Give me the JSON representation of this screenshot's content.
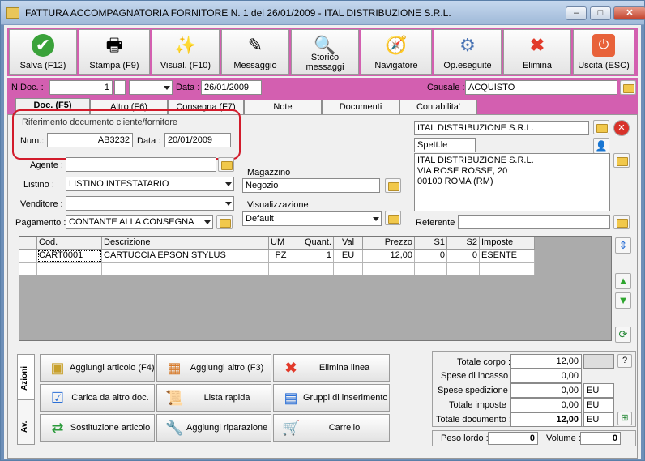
{
  "window": {
    "title": "FATTURA ACCOMPAGNATORIA FORNITORE N. 1  del 26/01/2009 - ITAL DISTRIBUZIONE S.R.L.",
    "min": "–",
    "max": "□",
    "close": "✕"
  },
  "toolbar": {
    "salva": "Salva (F12)",
    "stampa": "Stampa (F9)",
    "visual": "Visual. (F10)",
    "messaggio": "Messaggio",
    "storico": "Storico\nmessaggi",
    "navigatore": "Navigatore",
    "opeseguite": "Op.eseguite",
    "elimina": "Elimina",
    "uscita": "Uscita (ESC)"
  },
  "header": {
    "ndoc_label": "N.Doc. :",
    "ndoc_value": "1",
    "data_label": "Data :",
    "data_value": "26/01/2009",
    "causale_label": "Causale :",
    "causale_value": "ACQUISTO"
  },
  "tabs": [
    "Doc. (F5)",
    "Altro (F6)",
    "Consegna (F7)",
    "Note",
    "Documenti",
    "Contabilita'"
  ],
  "riferimento": {
    "title": "Riferimento documento cliente/fornitore",
    "num_label": "Num.:",
    "num_value": "AB3232",
    "data_label": "Data :",
    "data_value": "20/01/2009"
  },
  "form": {
    "agente_label": "Agente :",
    "agente_value": "",
    "listino_label": "Listino :",
    "listino_value": "LISTINO INTESTATARIO",
    "venditore_label": "Venditore :",
    "venditore_value": "",
    "pagamento_label": "Pagamento :",
    "pagamento_value": "CONTANTE ALLA CONSEGNA",
    "magazzino_label": "Magazzino",
    "magazzino_value": "Negozio",
    "visualizzazione_label": "Visualizzazione",
    "visualizzazione_value": "Default"
  },
  "cliente": {
    "name": "ITAL DISTRIBUZIONE S.R.L.",
    "spett": "Spett.le",
    "address": [
      "ITAL DISTRIBUZIONE S.R.L.",
      "VIA ROSE ROSSE, 20",
      "00100 ROMA (RM)"
    ],
    "referente_label": "Referente",
    "referente_value": ""
  },
  "grid": {
    "columns": [
      "Cod.",
      "Descrizione",
      "UM",
      "Quant.",
      "Val",
      "Prezzo",
      "S1",
      "S2",
      "Imposte"
    ],
    "rows": [
      [
        "CART0001",
        "CARTUCCIA EPSON STYLUS",
        "PZ",
        "1",
        "EU",
        "12,00",
        "0",
        "0",
        "ESENTE"
      ]
    ]
  },
  "actions": {
    "tab_azioni": "Azioni",
    "tab_av": "Av.",
    "aggiungi_articolo": "Aggiungi articolo (F4)",
    "aggiungi_altro": "Aggiungi altro (F3)",
    "elimina_linea": "Elimina linea",
    "carica": "Carica da altro doc.",
    "lista_rapida": "Lista rapida",
    "gruppi": "Gruppi di inserimento",
    "sostituzione": "Sostituzione articolo",
    "aggiungi_riparazione": "Aggiungi riparazione",
    "carrello": "Carrello"
  },
  "totals": {
    "corpo_label": "Totale corpo :",
    "corpo_value": "12,00",
    "help": "?",
    "incasso_label": "Spese di incasso :",
    "incasso_value": "0,00",
    "spedizione_label": "Spese spedizione :",
    "spedizione_value": "0,00",
    "spedizione_cur": "EU",
    "imposte_label": "Totale imposte :",
    "imposte_value": "0,00",
    "imposte_cur": "EU",
    "documento_label": "Totale documento :",
    "documento_value": "12,00",
    "documento_cur": "EU",
    "peso_label": "Peso lordo :",
    "peso_value": "0",
    "volume_label": "Volume :",
    "volume_value": "0"
  },
  "colors": {
    "magenta": "#d35fb0",
    "red_highlight": "#d21b2b"
  }
}
